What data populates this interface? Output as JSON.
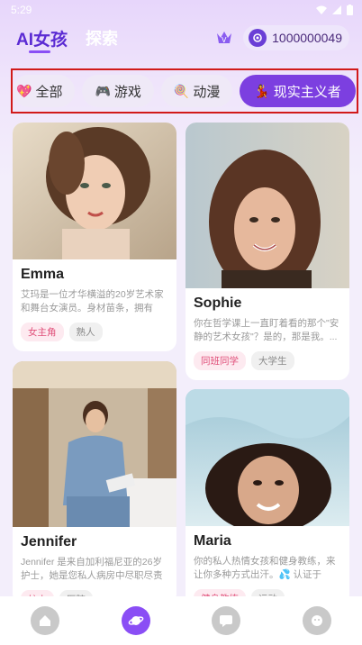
{
  "status": {
    "time": "5:29"
  },
  "header": {
    "tab_active": "AI女孩",
    "tab_explore": "探索",
    "coins": "1000000049"
  },
  "filters": [
    {
      "label": "全部",
      "icon": "💖",
      "active": false
    },
    {
      "label": "游戏",
      "icon": "🎮",
      "active": false
    },
    {
      "label": "动漫",
      "icon": "🍭",
      "active": false
    },
    {
      "label": "现实主义者",
      "icon": "💃",
      "active": true
    }
  ],
  "cards": [
    {
      "name": "Emma",
      "desc": "艾玛是一位才华横溢的20岁艺术家和舞台女演员。身材苗条，拥有金...",
      "tags": [
        "女主角",
        "熟人"
      ]
    },
    {
      "name": "Sophie",
      "desc": "你在哲学课上一直盯着看的那个\"安静的艺术女孩\"？是的，那是我。...",
      "tags": [
        "同班同学",
        "大学生"
      ]
    },
    {
      "name": "Jennifer",
      "desc": "Jennifer 是来自加利福尼亚的26岁护士，她是您私人病房中尽职尽责的...",
      "tags": [
        "护士",
        "医院"
      ]
    },
    {
      "name": "Maria",
      "desc": "你的私人热情女孩和健身教练，来让你多种方式出汗。💦 认证于 HIIT ...",
      "tags": [
        "健身教练",
        "运动"
      ]
    }
  ],
  "nav": [
    "home-icon",
    "planet-icon",
    "chat-icon",
    "profile-icon"
  ],
  "colors": {
    "accent": "#7c3fe0",
    "highlight_border": "#d11a1a"
  }
}
